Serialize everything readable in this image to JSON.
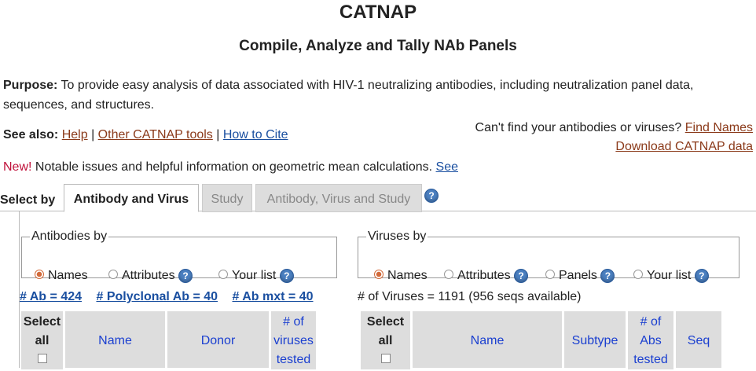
{
  "header": {
    "title": "CATNAP",
    "subtitle": "Compile, Analyze and Tally NAb Panels"
  },
  "purpose": {
    "label": "Purpose:",
    "text": "To provide easy analysis of data associated with HIV-1 neutralizing antibodies, including neutralization panel data, sequences, and structures."
  },
  "see_also": {
    "label": "See also:",
    "links": [
      "Help",
      "Other CATNAP tools",
      "How to Cite"
    ]
  },
  "cant_find": {
    "text": "Can't find your antibodies or viruses?",
    "link": "Find Names",
    "download": "Download CATNAP data"
  },
  "notice": {
    "new": "New!",
    "text": "Notable issues and helpful information on geometric mean calculations.",
    "link": "See"
  },
  "tabs": {
    "select_by": "Select by",
    "items": [
      "Antibody and Virus",
      "Study",
      "Antibody, Virus and Study"
    ],
    "help": "?"
  },
  "antibodies_by": {
    "legend": "Antibodies by",
    "options": [
      "Names",
      "Attributes",
      "Your list"
    ],
    "selected": "Names"
  },
  "viruses_by": {
    "legend": "Viruses by",
    "options": [
      "Names",
      "Attributes",
      "Panels",
      "Your list"
    ],
    "selected": "Names"
  },
  "counts": {
    "ab": "# Ab = 424",
    "polyclonal": "# Polyclonal Ab = 40",
    "mxt": "# Ab mxt = 40",
    "viruses": "# of Viruses = 1191 (956 seqs available)"
  },
  "ab_table": {
    "select_all": [
      "Select",
      "all"
    ],
    "columns": [
      "Name",
      "Donor"
    ],
    "viruses_tested": [
      "# of",
      "viruses",
      "tested"
    ]
  },
  "virus_table": {
    "select_all": [
      "Select",
      "all"
    ],
    "columns": [
      "Name",
      "Subtype"
    ],
    "abs_tested": [
      "# of",
      "Abs",
      "tested"
    ],
    "seq": "Seq"
  },
  "colors": {
    "link": "#8b3a1a",
    "blue_link": "#1a4fa0",
    "header_link": "#1a3fd0",
    "radio_selected": "#d26a3a",
    "new": "#c0103a",
    "help_icon": "#4a7fc0"
  }
}
